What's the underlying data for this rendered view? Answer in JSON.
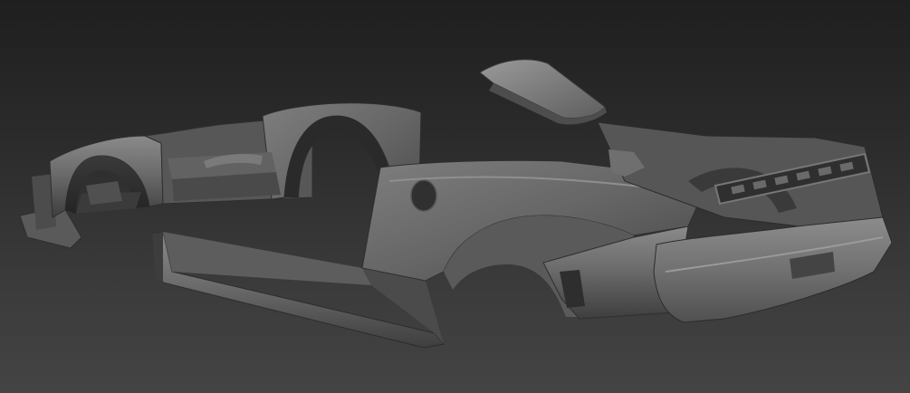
{
  "viewport": {
    "background_top": "#1f1f1f",
    "background_bottom": "#444444"
  },
  "model": {
    "parts": [
      {
        "name": "front-clip"
      },
      {
        "name": "side-skirt"
      },
      {
        "name": "door-frame"
      },
      {
        "name": "rear-quarter-panel"
      },
      {
        "name": "rear-wing-hood"
      },
      {
        "name": "rear-bumper"
      },
      {
        "name": "tail-light-frame"
      }
    ],
    "material_colors": {
      "base": "#6a6a6a",
      "highlight": "#8e8e8e",
      "shadow": "#2e2e2e"
    }
  }
}
